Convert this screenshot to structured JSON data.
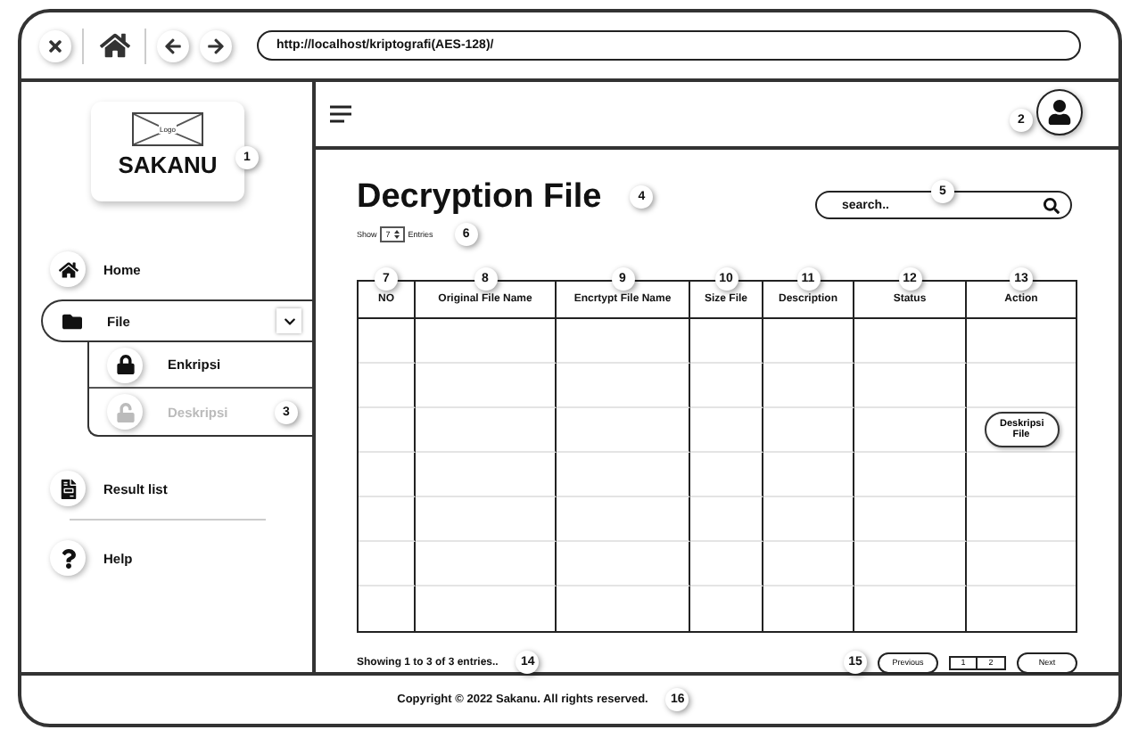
{
  "browser": {
    "address": "http://localhost/kriptografi(AES-128)/"
  },
  "logo": {
    "image_text": "Logo",
    "name": "SAKANU",
    "callout": "1"
  },
  "profile": {
    "callout": "2"
  },
  "nav": [
    {
      "label": "Home",
      "kind": "item"
    },
    {
      "label": "File",
      "kind": "group",
      "expanded": true,
      "children": [
        {
          "label": "Enkripsi",
          "selected": false
        },
        {
          "label": "Deskripsi",
          "selected": true,
          "callout": "3"
        }
      ]
    },
    {
      "label": "Result list",
      "kind": "item"
    },
    {
      "label": "Help",
      "kind": "item"
    }
  ],
  "page": {
    "title": "Decryption File",
    "title_callout": "4",
    "search": {
      "placeholder": "search..",
      "callout": "5"
    },
    "entries": {
      "before": "Show",
      "value": "7",
      "after": "Entries",
      "callout": "6"
    }
  },
  "table": {
    "columns": [
      {
        "label": "NO",
        "callout": "7"
      },
      {
        "label": "Original File Name",
        "callout": "8"
      },
      {
        "label": "Encrtypt File Name",
        "callout": "9"
      },
      {
        "label": "Size File",
        "callout": "10"
      },
      {
        "label": "Description",
        "callout": "11"
      },
      {
        "label": "Status",
        "callout": "12"
      },
      {
        "label": "Action",
        "callout": "13"
      }
    ],
    "rows": [
      {
        "kind": "empty"
      },
      {
        "kind": "empty"
      },
      {
        "kind": "action",
        "action_button": "Deskripsi File"
      },
      {
        "kind": "empty"
      },
      {
        "kind": "empty"
      },
      {
        "kind": "empty"
      },
      {
        "kind": "empty"
      }
    ]
  },
  "info": {
    "text": "Showing 1 to 3 of 3 entries..",
    "callout": "14"
  },
  "pagination": {
    "callout": "15",
    "previous": "Previous",
    "pages": [
      "1",
      "2"
    ],
    "next": "Next"
  },
  "footer": {
    "text": "Copyright © 2022 Sakanu. All rights reserved.",
    "callout": "16"
  }
}
